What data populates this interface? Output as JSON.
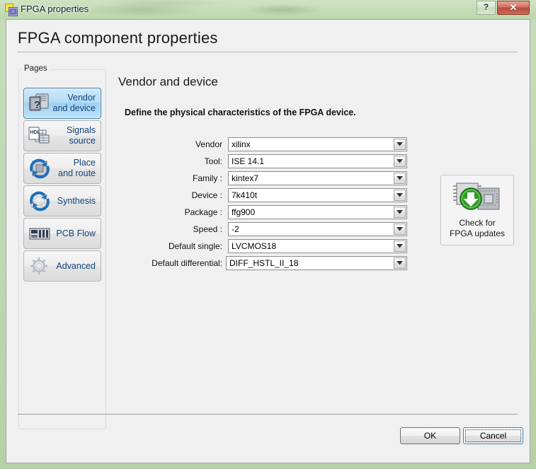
{
  "window": {
    "title": "FPGA properties",
    "icon": "fpga-chip-icon",
    "help_glyph": "?",
    "close_glyph": "✕"
  },
  "page": {
    "title": "FPGA component properties"
  },
  "pages_group": {
    "legend": "Pages",
    "items": [
      {
        "label": "Vendor\nand device",
        "icon": "vendor-device-icon",
        "selected": true
      },
      {
        "label": "Signals\nsource",
        "icon": "hdl-signals-icon",
        "selected": false
      },
      {
        "label": "Place\nand route",
        "icon": "place-route-icon",
        "selected": false
      },
      {
        "label": "Synthesis",
        "icon": "synthesis-icon",
        "selected": false
      },
      {
        "label": "PCB Flow",
        "icon": "pcb-flow-icon",
        "selected": false
      },
      {
        "label": "Advanced",
        "icon": "gear-icon",
        "selected": false
      }
    ]
  },
  "content": {
    "section_title": "Vendor and device",
    "description": "Define the physical characteristics of the FPGA device.",
    "fields": [
      {
        "label": "Vendor",
        "value": "xilinx"
      },
      {
        "label": "Tool:",
        "value": "ISE 14.1"
      },
      {
        "label": "Family :",
        "value": "kintex7"
      },
      {
        "label": "Device :",
        "value": "7k410t"
      },
      {
        "label": "Package :",
        "value": "ffg900"
      },
      {
        "label": "Speed :",
        "value": "-2"
      },
      {
        "label": "Default single:",
        "value": "LVCMOS18"
      },
      {
        "label": "Default differential:",
        "value": "DIFF_HSTL_II_18"
      }
    ],
    "update_tile": {
      "label": "Check for\nFPGA updates",
      "icon": "download-chip-icon"
    }
  },
  "footer": {
    "ok_label": "OK",
    "cancel_label": "Cancel"
  },
  "colors": {
    "frame": "#bfd9b2",
    "selection": "#3c7fb1",
    "link_text": "#14417a",
    "close_button": "#b64d3c",
    "update_arrow": "#2f9b24"
  }
}
